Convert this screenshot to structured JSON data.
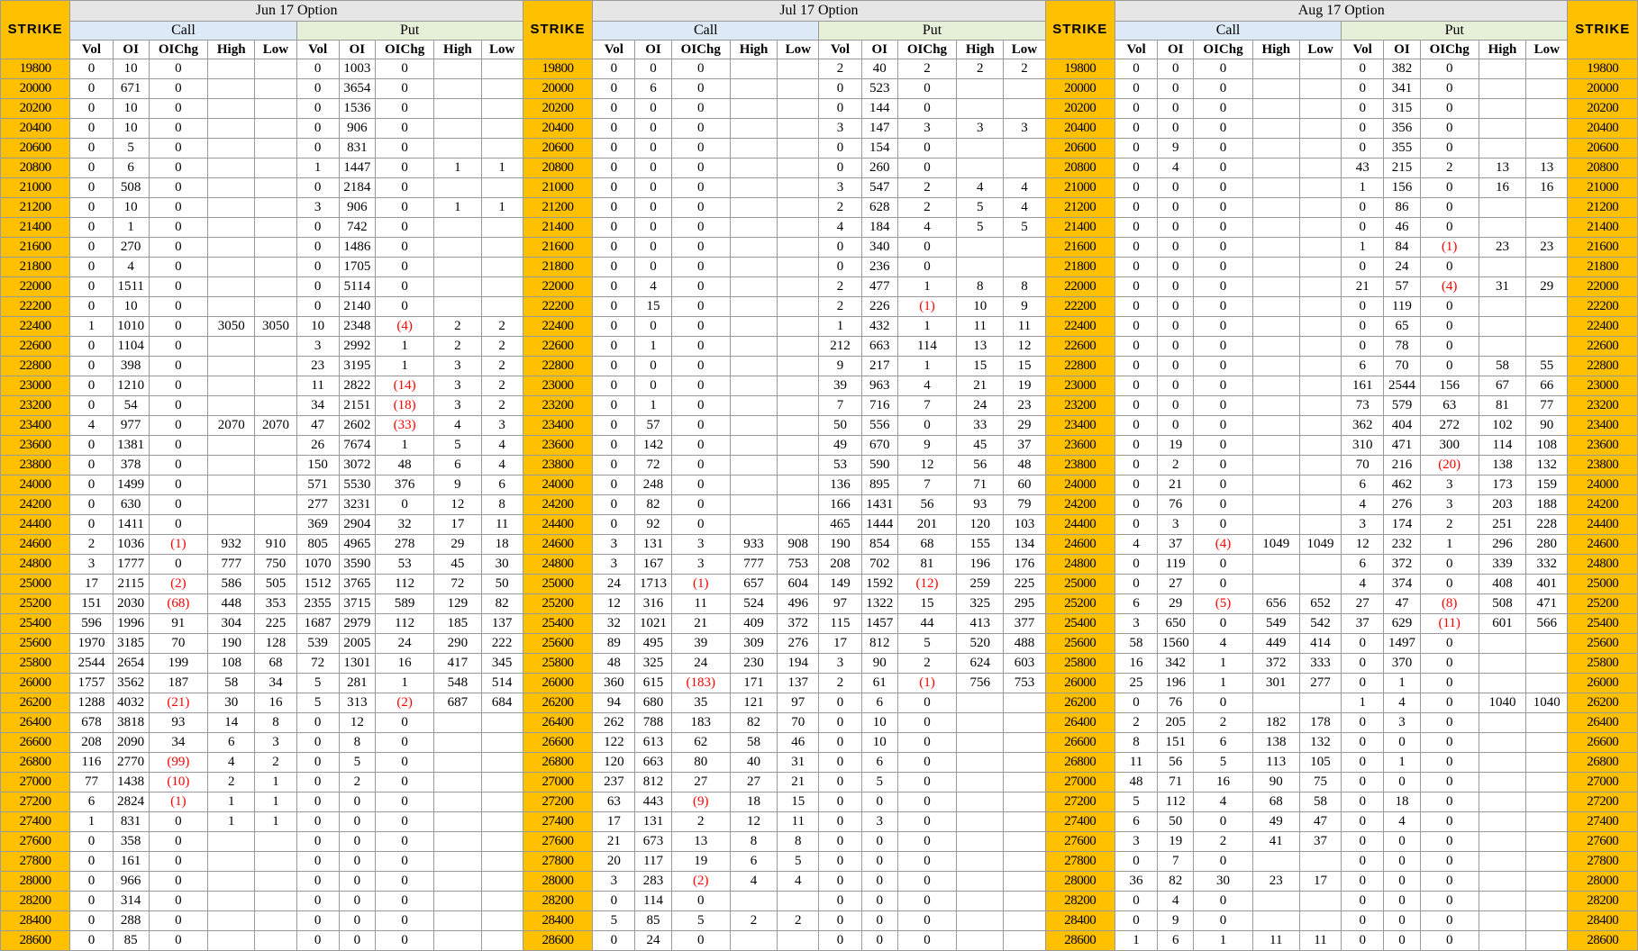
{
  "strike_label": "STRIKE",
  "months": [
    "Jun 17 Option",
    "Jul 17 Option",
    "Aug 17 Option"
  ],
  "call_label": "Call",
  "put_label": "Put",
  "columns": [
    "Vol",
    "OI",
    "OIChg",
    "High",
    "Low"
  ],
  "colors": {
    "strike_bg": "#ffc000",
    "call_bg": "#dde9f6",
    "put_bg": "#e6f0d8",
    "month_bg": "#e6e6e6",
    "negative": "#ff0000"
  },
  "rows": [
    [
      "19800",
      "0",
      "10",
      "0",
      "",
      "",
      "0",
      "1003",
      "0",
      "",
      "",
      "0",
      "0",
      "0",
      "",
      "",
      "2",
      "40",
      "2",
      "2",
      "2",
      "0",
      "0",
      "0",
      "",
      "",
      "0",
      "382",
      "0",
      "",
      ""
    ],
    [
      "20000",
      "0",
      "671",
      "0",
      "",
      "",
      "0",
      "3654",
      "0",
      "",
      "",
      "0",
      "6",
      "0",
      "",
      "",
      "0",
      "523",
      "0",
      "",
      "",
      "0",
      "0",
      "0",
      "",
      "",
      "0",
      "341",
      "0",
      "",
      ""
    ],
    [
      "20200",
      "0",
      "10",
      "0",
      "",
      "",
      "0",
      "1536",
      "0",
      "",
      "",
      "0",
      "0",
      "0",
      "",
      "",
      "0",
      "144",
      "0",
      "",
      "",
      "0",
      "0",
      "0",
      "",
      "",
      "0",
      "315",
      "0",
      "",
      ""
    ],
    [
      "20400",
      "0",
      "10",
      "0",
      "",
      "",
      "0",
      "906",
      "0",
      "",
      "",
      "0",
      "0",
      "0",
      "",
      "",
      "3",
      "147",
      "3",
      "3",
      "3",
      "0",
      "0",
      "0",
      "",
      "",
      "0",
      "356",
      "0",
      "",
      ""
    ],
    [
      "20600",
      "0",
      "5",
      "0",
      "",
      "",
      "0",
      "831",
      "0",
      "",
      "",
      "0",
      "0",
      "0",
      "",
      "",
      "0",
      "154",
      "0",
      "",
      "",
      "0",
      "9",
      "0",
      "",
      "",
      "0",
      "355",
      "0",
      "",
      ""
    ],
    [
      "20800",
      "0",
      "6",
      "0",
      "",
      "",
      "1",
      "1447",
      "0",
      "1",
      "1",
      "0",
      "0",
      "0",
      "",
      "",
      "0",
      "260",
      "0",
      "",
      "",
      "0",
      "4",
      "0",
      "",
      "",
      "43",
      "215",
      "2",
      "13",
      "13"
    ],
    [
      "21000",
      "0",
      "508",
      "0",
      "",
      "",
      "0",
      "2184",
      "0",
      "",
      "",
      "0",
      "0",
      "0",
      "",
      "",
      "3",
      "547",
      "2",
      "4",
      "4",
      "0",
      "0",
      "0",
      "",
      "",
      "1",
      "156",
      "0",
      "16",
      "16"
    ],
    [
      "21200",
      "0",
      "10",
      "0",
      "",
      "",
      "3",
      "906",
      "0",
      "1",
      "1",
      "0",
      "0",
      "0",
      "",
      "",
      "2",
      "628",
      "2",
      "5",
      "4",
      "0",
      "0",
      "0",
      "",
      "",
      "0",
      "86",
      "0",
      "",
      ""
    ],
    [
      "21400",
      "0",
      "1",
      "0",
      "",
      "",
      "0",
      "742",
      "0",
      "",
      "",
      "0",
      "0",
      "0",
      "",
      "",
      "4",
      "184",
      "4",
      "5",
      "5",
      "0",
      "0",
      "0",
      "",
      "",
      "0",
      "46",
      "0",
      "",
      ""
    ],
    [
      "21600",
      "0",
      "270",
      "0",
      "",
      "",
      "0",
      "1486",
      "0",
      "",
      "",
      "0",
      "0",
      "0",
      "",
      "",
      "0",
      "340",
      "0",
      "",
      "",
      "0",
      "0",
      "0",
      "",
      "",
      "1",
      "84",
      "(1)",
      "23",
      "23"
    ],
    [
      "21800",
      "0",
      "4",
      "0",
      "",
      "",
      "0",
      "1705",
      "0",
      "",
      "",
      "0",
      "0",
      "0",
      "",
      "",
      "0",
      "236",
      "0",
      "",
      "",
      "0",
      "0",
      "0",
      "",
      "",
      "0",
      "24",
      "0",
      "",
      ""
    ],
    [
      "22000",
      "0",
      "1511",
      "0",
      "",
      "",
      "0",
      "5114",
      "0",
      "",
      "",
      "0",
      "4",
      "0",
      "",
      "",
      "2",
      "477",
      "1",
      "8",
      "8",
      "0",
      "0",
      "0",
      "",
      "",
      "21",
      "57",
      "(4)",
      "31",
      "29"
    ],
    [
      "22200",
      "0",
      "10",
      "0",
      "",
      "",
      "0",
      "2140",
      "0",
      "",
      "",
      "0",
      "15",
      "0",
      "",
      "",
      "2",
      "226",
      "(1)",
      "10",
      "9",
      "0",
      "0",
      "0",
      "",
      "",
      "0",
      "119",
      "0",
      "",
      ""
    ],
    [
      "22400",
      "1",
      "1010",
      "0",
      "3050",
      "3050",
      "10",
      "2348",
      "(4)",
      "2",
      "2",
      "0",
      "0",
      "0",
      "",
      "",
      "1",
      "432",
      "1",
      "11",
      "11",
      "0",
      "0",
      "0",
      "",
      "",
      "0",
      "65",
      "0",
      "",
      ""
    ],
    [
      "22600",
      "0",
      "1104",
      "0",
      "",
      "",
      "3",
      "2992",
      "1",
      "2",
      "2",
      "0",
      "1",
      "0",
      "",
      "",
      "212",
      "663",
      "114",
      "13",
      "12",
      "0",
      "0",
      "0",
      "",
      "",
      "0",
      "78",
      "0",
      "",
      ""
    ],
    [
      "22800",
      "0",
      "398",
      "0",
      "",
      "",
      "23",
      "3195",
      "1",
      "3",
      "2",
      "0",
      "0",
      "0",
      "",
      "",
      "9",
      "217",
      "1",
      "15",
      "15",
      "0",
      "0",
      "0",
      "",
      "",
      "6",
      "70",
      "0",
      "58",
      "55"
    ],
    [
      "23000",
      "0",
      "1210",
      "0",
      "",
      "",
      "11",
      "2822",
      "(14)",
      "3",
      "2",
      "0",
      "0",
      "0",
      "",
      "",
      "39",
      "963",
      "4",
      "21",
      "19",
      "0",
      "0",
      "0",
      "",
      "",
      "161",
      "2544",
      "156",
      "67",
      "66"
    ],
    [
      "23200",
      "0",
      "54",
      "0",
      "",
      "",
      "34",
      "2151",
      "(18)",
      "3",
      "2",
      "0",
      "1",
      "0",
      "",
      "",
      "7",
      "716",
      "7",
      "24",
      "23",
      "0",
      "0",
      "0",
      "",
      "",
      "73",
      "579",
      "63",
      "81",
      "77"
    ],
    [
      "23400",
      "4",
      "977",
      "0",
      "2070",
      "2070",
      "47",
      "2602",
      "(33)",
      "4",
      "3",
      "0",
      "57",
      "0",
      "",
      "",
      "50",
      "556",
      "0",
      "33",
      "29",
      "0",
      "0",
      "0",
      "",
      "",
      "362",
      "404",
      "272",
      "102",
      "90"
    ],
    [
      "23600",
      "0",
      "1381",
      "0",
      "",
      "",
      "26",
      "7674",
      "1",
      "5",
      "4",
      "0",
      "142",
      "0",
      "",
      "",
      "49",
      "670",
      "9",
      "45",
      "37",
      "0",
      "19",
      "0",
      "",
      "",
      "310",
      "471",
      "300",
      "114",
      "108"
    ],
    [
      "23800",
      "0",
      "378",
      "0",
      "",
      "",
      "150",
      "3072",
      "48",
      "6",
      "4",
      "0",
      "72",
      "0",
      "",
      "",
      "53",
      "590",
      "12",
      "56",
      "48",
      "0",
      "2",
      "0",
      "",
      "",
      "70",
      "216",
      "(20)",
      "138",
      "132"
    ],
    [
      "24000",
      "0",
      "1499",
      "0",
      "",
      "",
      "571",
      "5530",
      "376",
      "9",
      "6",
      "0",
      "248",
      "0",
      "",
      "",
      "136",
      "895",
      "7",
      "71",
      "60",
      "0",
      "21",
      "0",
      "",
      "",
      "6",
      "462",
      "3",
      "173",
      "159"
    ],
    [
      "24200",
      "0",
      "630",
      "0",
      "",
      "",
      "277",
      "3231",
      "0",
      "12",
      "8",
      "0",
      "82",
      "0",
      "",
      "",
      "166",
      "1431",
      "56",
      "93",
      "79",
      "0",
      "76",
      "0",
      "",
      "",
      "4",
      "276",
      "3",
      "203",
      "188"
    ],
    [
      "24400",
      "0",
      "1411",
      "0",
      "",
      "",
      "369",
      "2904",
      "32",
      "17",
      "11",
      "0",
      "92",
      "0",
      "",
      "",
      "465",
      "1444",
      "201",
      "120",
      "103",
      "0",
      "3",
      "0",
      "",
      "",
      "3",
      "174",
      "2",
      "251",
      "228"
    ],
    [
      "24600",
      "2",
      "1036",
      "(1)",
      "932",
      "910",
      "805",
      "4965",
      "278",
      "29",
      "18",
      "3",
      "131",
      "3",
      "933",
      "908",
      "190",
      "854",
      "68",
      "155",
      "134",
      "4",
      "37",
      "(4)",
      "1049",
      "1049",
      "12",
      "232",
      "1",
      "296",
      "280"
    ],
    [
      "24800",
      "3",
      "1777",
      "0",
      "777",
      "750",
      "1070",
      "3590",
      "53",
      "45",
      "30",
      "3",
      "167",
      "3",
      "777",
      "753",
      "208",
      "702",
      "81",
      "196",
      "176",
      "0",
      "119",
      "0",
      "",
      "",
      "6",
      "372",
      "0",
      "339",
      "332"
    ],
    [
      "25000",
      "17",
      "2115",
      "(2)",
      "586",
      "505",
      "1512",
      "3765",
      "112",
      "72",
      "50",
      "24",
      "1713",
      "(1)",
      "657",
      "604",
      "149",
      "1592",
      "(12)",
      "259",
      "225",
      "0",
      "27",
      "0",
      "",
      "",
      "4",
      "374",
      "0",
      "408",
      "401"
    ],
    [
      "25200",
      "151",
      "2030",
      "(68)",
      "448",
      "353",
      "2355",
      "3715",
      "589",
      "129",
      "82",
      "12",
      "316",
      "11",
      "524",
      "496",
      "97",
      "1322",
      "15",
      "325",
      "295",
      "6",
      "29",
      "(5)",
      "656",
      "652",
      "27",
      "47",
      "(8)",
      "508",
      "471"
    ],
    [
      "25400",
      "596",
      "1996",
      "91",
      "304",
      "225",
      "1687",
      "2979",
      "112",
      "185",
      "137",
      "32",
      "1021",
      "21",
      "409",
      "372",
      "115",
      "1457",
      "44",
      "413",
      "377",
      "3",
      "650",
      "0",
      "549",
      "542",
      "37",
      "629",
      "(11)",
      "601",
      "566"
    ],
    [
      "25600",
      "1970",
      "3185",
      "70",
      "190",
      "128",
      "539",
      "2005",
      "24",
      "290",
      "222",
      "89",
      "495",
      "39",
      "309",
      "276",
      "17",
      "812",
      "5",
      "520",
      "488",
      "58",
      "1560",
      "4",
      "449",
      "414",
      "0",
      "1497",
      "0",
      "",
      ""
    ],
    [
      "25800",
      "2544",
      "2654",
      "199",
      "108",
      "68",
      "72",
      "1301",
      "16",
      "417",
      "345",
      "48",
      "325",
      "24",
      "230",
      "194",
      "3",
      "90",
      "2",
      "624",
      "603",
      "16",
      "342",
      "1",
      "372",
      "333",
      "0",
      "370",
      "0",
      "",
      ""
    ],
    [
      "26000",
      "1757",
      "3562",
      "187",
      "58",
      "34",
      "5",
      "281",
      "1",
      "548",
      "514",
      "360",
      "615",
      "(183)",
      "171",
      "137",
      "2",
      "61",
      "(1)",
      "756",
      "753",
      "25",
      "196",
      "1",
      "301",
      "277",
      "0",
      "1",
      "0",
      "",
      ""
    ],
    [
      "26200",
      "1288",
      "4032",
      "(21)",
      "30",
      "16",
      "5",
      "313",
      "(2)",
      "687",
      "684",
      "94",
      "680",
      "35",
      "121",
      "97",
      "0",
      "6",
      "0",
      "",
      "",
      "0",
      "76",
      "0",
      "",
      "",
      "1",
      "4",
      "0",
      "1040",
      "1040"
    ],
    [
      "26400",
      "678",
      "3818",
      "93",
      "14",
      "8",
      "0",
      "12",
      "0",
      "",
      "",
      "262",
      "788",
      "183",
      "82",
      "70",
      "0",
      "10",
      "0",
      "",
      "",
      "2",
      "205",
      "2",
      "182",
      "178",
      "0",
      "3",
      "0",
      "",
      ""
    ],
    [
      "26600",
      "208",
      "2090",
      "34",
      "6",
      "3",
      "0",
      "8",
      "0",
      "",
      "",
      "122",
      "613",
      "62",
      "58",
      "46",
      "0",
      "10",
      "0",
      "",
      "",
      "8",
      "151",
      "6",
      "138",
      "132",
      "0",
      "0",
      "0",
      "",
      ""
    ],
    [
      "26800",
      "116",
      "2770",
      "(99)",
      "4",
      "2",
      "0",
      "5",
      "0",
      "",
      "",
      "120",
      "663",
      "80",
      "40",
      "31",
      "0",
      "6",
      "0",
      "",
      "",
      "11",
      "56",
      "5",
      "113",
      "105",
      "0",
      "1",
      "0",
      "",
      ""
    ],
    [
      "27000",
      "77",
      "1438",
      "(10)",
      "2",
      "1",
      "0",
      "2",
      "0",
      "",
      "",
      "237",
      "812",
      "27",
      "27",
      "21",
      "0",
      "5",
      "0",
      "",
      "",
      "48",
      "71",
      "16",
      "90",
      "75",
      "0",
      "0",
      "0",
      "",
      ""
    ],
    [
      "27200",
      "6",
      "2824",
      "(1)",
      "1",
      "1",
      "0",
      "0",
      "0",
      "",
      "",
      "63",
      "443",
      "(9)",
      "18",
      "15",
      "0",
      "0",
      "0",
      "",
      "",
      "5",
      "112",
      "4",
      "68",
      "58",
      "0",
      "18",
      "0",
      "",
      ""
    ],
    [
      "27400",
      "1",
      "831",
      "0",
      "1",
      "1",
      "0",
      "0",
      "0",
      "",
      "",
      "17",
      "131",
      "2",
      "12",
      "11",
      "0",
      "3",
      "0",
      "",
      "",
      "6",
      "50",
      "0",
      "49",
      "47",
      "0",
      "4",
      "0",
      "",
      ""
    ],
    [
      "27600",
      "0",
      "358",
      "0",
      "",
      "",
      "0",
      "0",
      "0",
      "",
      "",
      "21",
      "673",
      "13",
      "8",
      "8",
      "0",
      "0",
      "0",
      "",
      "",
      "3",
      "19",
      "2",
      "41",
      "37",
      "0",
      "0",
      "0",
      "",
      ""
    ],
    [
      "27800",
      "0",
      "161",
      "0",
      "",
      "",
      "0",
      "0",
      "0",
      "",
      "",
      "20",
      "117",
      "19",
      "6",
      "5",
      "0",
      "0",
      "0",
      "",
      "",
      "0",
      "7",
      "0",
      "",
      "",
      "0",
      "0",
      "0",
      "",
      ""
    ],
    [
      "28000",
      "0",
      "966",
      "0",
      "",
      "",
      "0",
      "0",
      "0",
      "",
      "",
      "3",
      "283",
      "(2)",
      "4",
      "4",
      "0",
      "0",
      "0",
      "",
      "",
      "36",
      "82",
      "30",
      "23",
      "17",
      "0",
      "0",
      "0",
      "",
      ""
    ],
    [
      "28200",
      "0",
      "314",
      "0",
      "",
      "",
      "0",
      "0",
      "0",
      "",
      "",
      "0",
      "114",
      "0",
      "",
      "",
      "0",
      "0",
      "0",
      "",
      "",
      "0",
      "4",
      "0",
      "",
      "",
      "0",
      "0",
      "0",
      "",
      ""
    ],
    [
      "28400",
      "0",
      "288",
      "0",
      "",
      "",
      "0",
      "0",
      "0",
      "",
      "",
      "5",
      "85",
      "5",
      "2",
      "2",
      "0",
      "0",
      "0",
      "",
      "",
      "0",
      "9",
      "0",
      "",
      "",
      "0",
      "0",
      "0",
      "",
      ""
    ],
    [
      "28600",
      "0",
      "85",
      "0",
      "",
      "",
      "0",
      "0",
      "0",
      "",
      "",
      "0",
      "24",
      "0",
      "",
      "",
      "0",
      "0",
      "0",
      "",
      "",
      "1",
      "6",
      "1",
      "11",
      "11",
      "0",
      "0",
      "0",
      "",
      ""
    ]
  ]
}
